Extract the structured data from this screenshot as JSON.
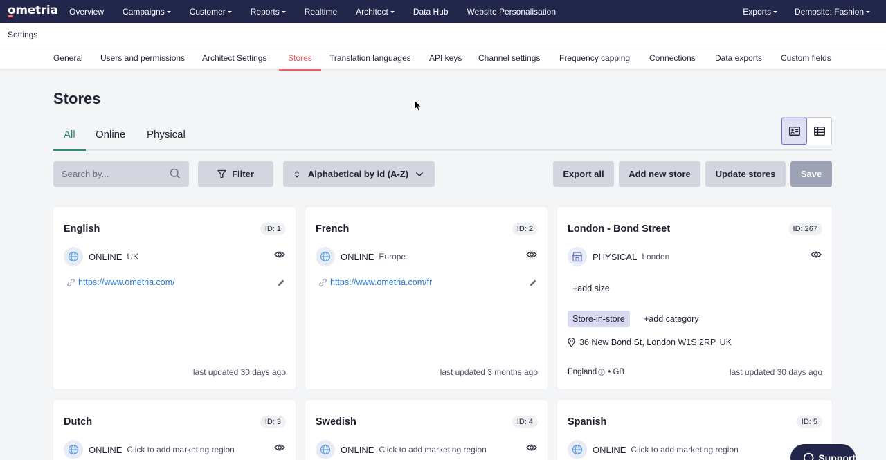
{
  "app": {
    "logo": "ometria"
  },
  "topnav": {
    "items": [
      {
        "label": "Overview",
        "dropdown": false
      },
      {
        "label": "Campaigns",
        "dropdown": true
      },
      {
        "label": "Customer",
        "dropdown": true
      },
      {
        "label": "Reports",
        "dropdown": true
      },
      {
        "label": "Realtime",
        "dropdown": false
      },
      {
        "label": "Architect",
        "dropdown": true
      },
      {
        "label": "Data Hub",
        "dropdown": false
      },
      {
        "label": "Website Personalisation",
        "dropdown": false
      }
    ],
    "right": [
      {
        "label": "Exports",
        "dropdown": true
      },
      {
        "label": "Demosite: Fashion",
        "dropdown": true
      }
    ]
  },
  "breadcrumb": {
    "label": "Settings"
  },
  "subtabs": [
    "General",
    "Users and permissions",
    "Architect Settings",
    "Stores",
    "Translation languages",
    "API keys",
    "Channel settings",
    "Frequency capping",
    "Connections",
    "Data exports",
    "Custom fields"
  ],
  "page": {
    "title": "Stores"
  },
  "tabs": [
    "All",
    "Online",
    "Physical"
  ],
  "toolbar": {
    "search_placeholder": "Search by...",
    "filter": "Filter",
    "sort": "Alphabetical by id (A-Z)",
    "export_all": "Export all",
    "add_new": "Add new store",
    "update": "Update stores",
    "save": "Save"
  },
  "cards": [
    {
      "name": "English",
      "id": "ID: 1",
      "type": "ONLINE",
      "region": "UK",
      "url": "https://www.ometria.com/",
      "updated": "last updated 30 days ago"
    },
    {
      "name": "French",
      "id": "ID: 2",
      "type": "ONLINE",
      "region": "Europe",
      "url": "https://www.ometria.com/fr",
      "updated": "last updated 3 months ago"
    },
    {
      "name": "London - Bond Street",
      "id": "ID: 267",
      "type": "PHYSICAL",
      "region": "London",
      "add_size": "+add size",
      "tag": "Store-in-store",
      "add_category": "+add category",
      "address": "36 New Bond St, London W1S 2RP, UK",
      "country_region": "England",
      "country_code": "• GB",
      "updated": "last updated 30 days ago"
    },
    {
      "name": "Dutch",
      "id": "ID: 3",
      "type": "ONLINE",
      "region": "Click to add marketing region"
    },
    {
      "name": "Swedish",
      "id": "ID: 4",
      "type": "ONLINE",
      "region": "Click to add marketing region"
    },
    {
      "name": "Spanish",
      "id": "ID: 5",
      "type": "ONLINE",
      "region": "Click to add marketing region"
    }
  ],
  "support": {
    "label": "Support"
  },
  "colors": {
    "nav_bg": "#23264b",
    "accent_red": "#ef5d5d",
    "accent_green": "#2e8a77",
    "link": "#2a7bd0"
  }
}
